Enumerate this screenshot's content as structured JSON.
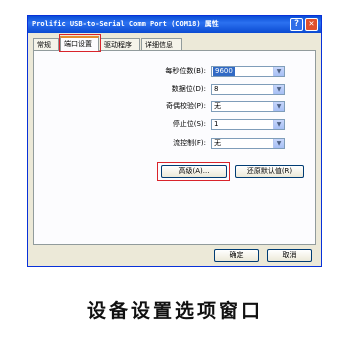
{
  "window": {
    "title": "Prolific USB-to-Serial Comm Port (COM18) 属性",
    "help_label": "?",
    "close_label": "✕"
  },
  "tabs": [
    {
      "label": "常规"
    },
    {
      "label": "端口设置"
    },
    {
      "label": "驱动程序"
    },
    {
      "label": "详细信息"
    }
  ],
  "settings": [
    {
      "label": "每秒位数(B):",
      "value": "9600"
    },
    {
      "label": "数据位(D):",
      "value": "8"
    },
    {
      "label": "奇偶校验(P):",
      "value": "无"
    },
    {
      "label": "停止位(S):",
      "value": "1"
    },
    {
      "label": "流控制(F):",
      "value": "无"
    }
  ],
  "buttons": {
    "advanced": "高级(A)...",
    "restore_defaults": "还原默认值(R)",
    "ok": "确定",
    "cancel": "取消"
  },
  "dropdown_arrow": "▼",
  "caption": "设备设置选项窗口",
  "colors": {
    "titlebar": "#0a4dd6",
    "highlight_box": "#d9242b",
    "dialog_bg": "#ece9d8"
  }
}
